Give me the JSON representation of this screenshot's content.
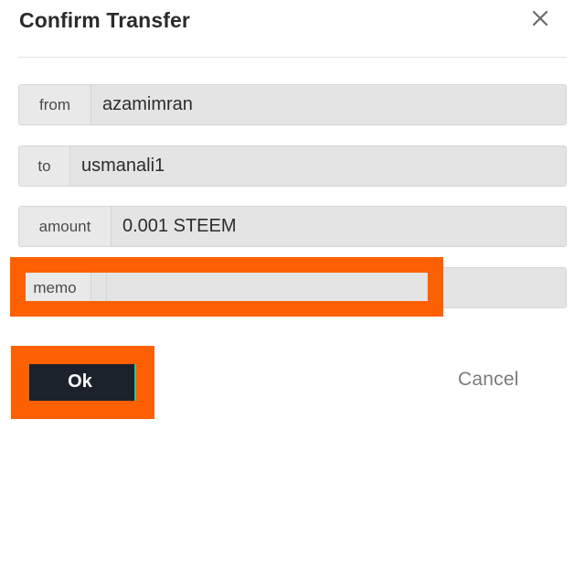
{
  "dialog": {
    "title": "Confirm Transfer",
    "close_icon": "close-icon"
  },
  "fields": [
    {
      "key": "from",
      "label": "from",
      "value": "azamimran"
    },
    {
      "key": "to",
      "label": "to",
      "value": "usmanali1"
    },
    {
      "key": "amount",
      "label": "amount",
      "value": "0.001 STEEM"
    },
    {
      "key": "memo",
      "label": "memo",
      "value": "",
      "placeholder": ""
    }
  ],
  "footer": {
    "ok_label": "Ok",
    "cancel_label": "Cancel"
  },
  "annotations": {
    "highlight_color": "#fc6000",
    "memo_highlight": "memo field highlighted",
    "ok_highlight": "ok button highlighted"
  },
  "colors": {
    "accent_teal": "#27c79a",
    "button_dark": "#1c222b",
    "field_background": "#e4e4e4",
    "label_background": "#e9e9e9",
    "highlight_orange": "#fc6000"
  }
}
